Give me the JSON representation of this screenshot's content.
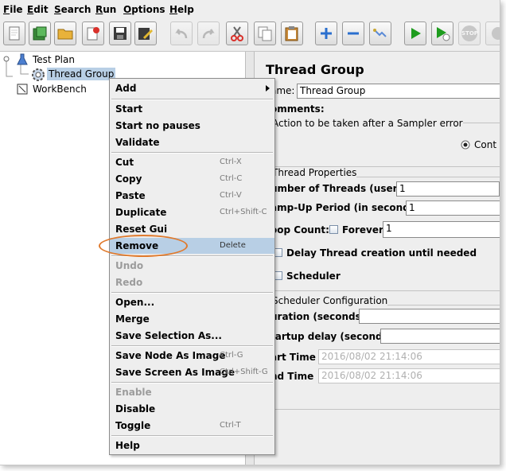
{
  "menubar": [
    {
      "label": "File",
      "u": "F",
      "rest": "ile"
    },
    {
      "label": "Edit",
      "u": "E",
      "rest": "dit"
    },
    {
      "label": "Search",
      "u": "S",
      "rest": "earch"
    },
    {
      "label": "Run",
      "u": "R",
      "rest": "un"
    },
    {
      "label": "Options",
      "u": "O",
      "rest": "ptions"
    },
    {
      "label": "Help",
      "u": "H",
      "rest": "elp"
    }
  ],
  "toolbar": {
    "icons": [
      "new-file-icon",
      "templates-icon",
      "open-folder-icon",
      "close-icon",
      "save-icon",
      "save-as-icon",
      "undo-icon",
      "redo-icon",
      "cut-icon",
      "copy-icon",
      "paste-icon",
      "expand-icon",
      "collapse-icon",
      "toggle-icon",
      "start-icon",
      "start-no-pauses-icon",
      "stop-icon",
      "shutdown-icon"
    ],
    "stop_label": "STOP"
  },
  "tree": {
    "test_plan": "Test Plan",
    "thread_group": "Thread Group",
    "workbench": "WorkBench"
  },
  "panel": {
    "title": "Thread Group",
    "name_label": "ame:",
    "name_value": "Thread Group",
    "comments_label": "omments:",
    "action_label": "Action to be taken after a Sampler error",
    "continue_label": "Cont",
    "thread_props_title": "Thread Properties",
    "num_threads_label": "umber of Threads (users):",
    "num_threads_value": "1",
    "rampup_label": "amp-Up Period (in seconds):",
    "rampup_value": "1",
    "loop_label": "oop Count:",
    "forever_label": "Forever",
    "loop_value": "1",
    "delay_label": "Delay Thread creation until needed",
    "scheduler_label": "Scheduler",
    "sched_config_title": "Scheduler Configuration",
    "duration_label": "uration (seconds)",
    "startup_delay_label": "tartup delay (seconds)",
    "start_time_label": "art Time",
    "start_time_value": "2016/08/02 21:14:06",
    "end_time_label": "nd Time",
    "end_time_value": "2016/08/02 21:14:06"
  },
  "context_menu": {
    "add": "Add",
    "start": "Start",
    "start_no_pauses": "Start no pauses",
    "validate": "Validate",
    "cut": "Cut",
    "cut_key": "Ctrl-X",
    "copy": "Copy",
    "copy_key": "Ctrl-C",
    "paste": "Paste",
    "paste_key": "Ctrl-V",
    "duplicate": "Duplicate",
    "duplicate_key": "Ctrl+Shift-C",
    "reset_gui": "Reset Gui",
    "remove": "Remove",
    "remove_key": "Delete",
    "undo": "Undo",
    "redo": "Redo",
    "open": "Open...",
    "merge": "Merge",
    "save_selection": "Save Selection As...",
    "save_node_image": "Save Node As Image",
    "save_node_image_key": "Ctrl-G",
    "save_screen_image": "Save Screen As Image",
    "save_screen_image_key": "Ctrl+Shift-G",
    "enable": "Enable",
    "disable": "Disable",
    "toggle": "Toggle",
    "toggle_key": "Ctrl-T",
    "help": "Help"
  },
  "colors": {
    "selection": "#b8cfe5",
    "highlight_ring": "#e07a2d",
    "run_green": "#1e9c1e"
  }
}
